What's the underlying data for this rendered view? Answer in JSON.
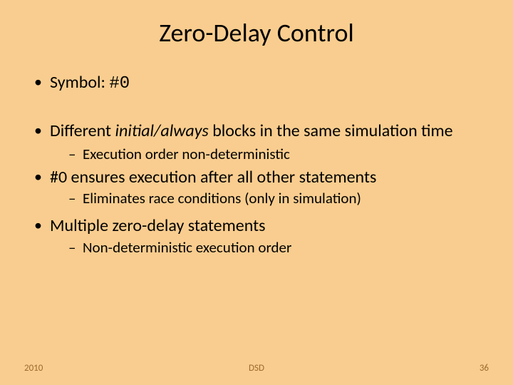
{
  "title": "Zero-Delay Control",
  "bullets": {
    "b1_prefix": "Symbol: ",
    "b1_symbol": "#0",
    "b2_prefix": "Different ",
    "b2_ital": "initial/always",
    "b2_suffix": " blocks in the same simulation time",
    "b2_sub1": "Execution order non-deterministic",
    "b3": "#0 ensures execution after all other statements",
    "b3_sub1": "Eliminates race conditions (only in simulation)",
    "b4": "Multiple zero-delay statements",
    "b4_sub1": "Non-deterministic execution order"
  },
  "footer": {
    "left": "2010",
    "center": "DSD",
    "right": "36"
  }
}
